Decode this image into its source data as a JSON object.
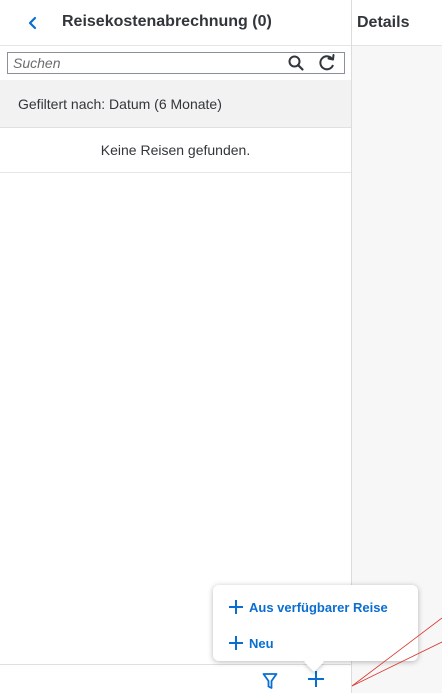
{
  "master": {
    "back_icon": "chevron-left-icon",
    "title": "Reisekostenabrechnung (0)",
    "search": {
      "placeholder": "Suchen",
      "value": ""
    },
    "search_icon": "search-icon",
    "refresh_icon": "refresh-icon",
    "filter_info": "Gefiltert nach: Datum (6 Monate)",
    "empty_text": "Keine Reisen gefunden."
  },
  "detail": {
    "title": "Details"
  },
  "footer": {
    "filter_icon": "filter-icon",
    "add_icon": "add-icon"
  },
  "popover": {
    "items": [
      {
        "label": "Aus verfügbarer Reise",
        "icon": "add-icon"
      },
      {
        "label": "Neu",
        "icon": "add-icon"
      }
    ]
  },
  "colors": {
    "accent": "#0a6ed1",
    "text": "#32363a",
    "filter_bar_bg": "#f2f2f2",
    "detail_bg": "#f7f7f7",
    "annotation_line": "#d9342b"
  }
}
